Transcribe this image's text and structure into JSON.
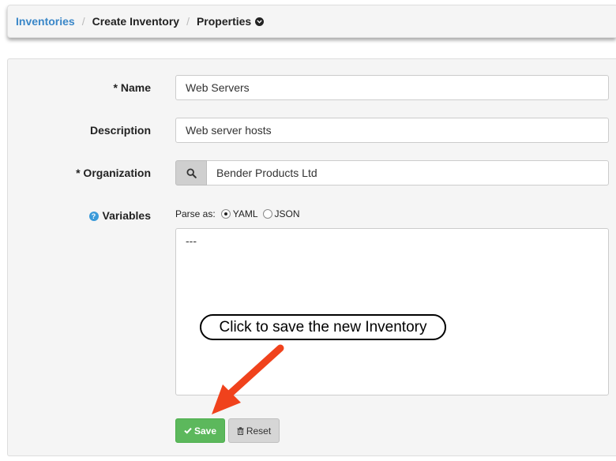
{
  "breadcrumb": {
    "items": [
      "Inventories",
      "Create Inventory",
      "Properties"
    ],
    "separator": "/"
  },
  "form": {
    "name": {
      "label": "* Name",
      "value": "Web Servers"
    },
    "description": {
      "label": "Description",
      "value": "Web server hosts"
    },
    "organization": {
      "label": "* Organization",
      "value": "Bender Products Ltd"
    },
    "variables": {
      "label": "Variables",
      "parse_as_label": "Parse as:",
      "options": [
        "YAML",
        "JSON"
      ],
      "selected": "YAML",
      "value": "---"
    },
    "buttons": {
      "save": "Save",
      "reset": "Reset"
    }
  },
  "annotation": {
    "callout": "Click to save the new Inventory"
  },
  "colors": {
    "link": "#3a87c8",
    "save_button": "#5cb85c",
    "reset_button": "#d6d6d6",
    "help_icon": "#3a9ad9",
    "arrow": "#f0421c"
  },
  "icons": {
    "chevron": "chevron-down-circle-icon",
    "org_lookup": "search-icon",
    "help": "question-circle-icon",
    "save": "check-icon",
    "reset": "trash-icon"
  }
}
